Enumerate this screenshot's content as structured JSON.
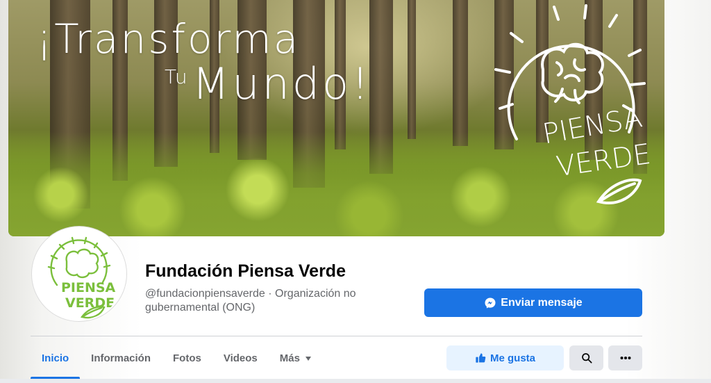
{
  "cover": {
    "title_line1": "¡Transforma",
    "title_tu": "Tu",
    "title_mundo": "Mundo!",
    "logo_text_1": "PIENSA",
    "logo_text_2": "VERDE"
  },
  "profile": {
    "name": "Fundación Piensa Verde",
    "subtitle": "@fundacionpiensaverde · Organización no gubernamental (ONG)",
    "avatar_text_1": "PIENSA",
    "avatar_text_2": "VERDE",
    "message_button": "Enviar mensaje"
  },
  "tabs": [
    {
      "label": "Inicio",
      "active": true
    },
    {
      "label": "Información"
    },
    {
      "label": "Fotos"
    },
    {
      "label": "Videos"
    },
    {
      "label": "Más"
    }
  ],
  "actions": {
    "like_button": "Me gusta"
  },
  "colors": {
    "accent": "#1b74e4",
    "accent_light": "#e7f3ff",
    "logo_green": "#7bbf3c"
  },
  "icons": {
    "message": "messenger-icon",
    "like": "thumbs-up-icon",
    "search": "search-icon",
    "more": "more-dots-icon",
    "dropdown": "caret-down-icon"
  }
}
